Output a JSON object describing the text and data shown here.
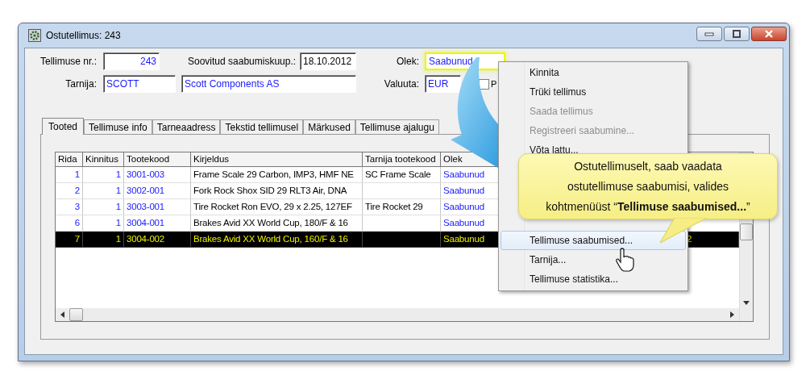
{
  "window": {
    "title": "Ostutellimus: 243"
  },
  "form": {
    "order_no_label": "Tellimuse nr.:",
    "order_no": "243",
    "date_label": "Soovitud saabumiskuup.:",
    "date": "18.10.2012",
    "status_label": "Olek:",
    "status": "Saabunud",
    "status_highlighted": true,
    "supplier_label": "Tarnija:",
    "supplier_code": "SCOTT",
    "supplier_name": "Scott Components AS",
    "currency_label": "Valuuta:",
    "currency": "EUR",
    "checkbox_checked": false,
    "checkbox_label": "P"
  },
  "tabs": [
    {
      "label": "Tooted",
      "selected": true
    },
    {
      "label": "Tellimuse info",
      "selected": false
    },
    {
      "label": "Tarneaadress",
      "selected": false
    },
    {
      "label": "Tekstid tellimusel",
      "selected": false
    },
    {
      "label": "Märkused",
      "selected": false
    },
    {
      "label": "Tellimuse ajalugu",
      "selected": false
    }
  ],
  "table": {
    "columns": [
      "Rida",
      "Kinnitus",
      "Tootekood",
      "Kirjeldus",
      "Tarnija tootekood",
      "Olek"
    ],
    "rows": [
      {
        "rida": "1",
        "kinnitus": "1",
        "tootekood": "3001-003",
        "kirjeldus": "Frame Scale 29 Carbon, IMP3, HMF NE",
        "tarnija_tootekood": "SC Frame Scale",
        "olek": "Saabunud",
        "selected": false
      },
      {
        "rida": "2",
        "kinnitus": "1",
        "tootekood": "3002-001",
        "kirjeldus": "Fork Rock Shox SID 29 RLT3 Air, DNA",
        "olek": "Saabunud",
        "selected": false
      },
      {
        "rida": "3",
        "kinnitus": "1",
        "tootekood": "3003-001",
        "kirjeldus": "Tire Rocket Ron EVO, 29 x 2.25, 127EF",
        "tarnija_tootekood": "Tire Rocket 29",
        "olek": "Saabunud",
        "selected": false
      },
      {
        "rida": "6",
        "kinnitus": "1",
        "tootekood": "3004-001",
        "kirjeldus": "Brakes Avid XX World Cup, 180/F & 16",
        "olek": "Saabunud",
        "selected": false
      },
      {
        "rida": "7",
        "kinnitus": "1",
        "tootekood": "3004-002",
        "kirjeldus": "Brakes Avid XX World Cup, 160/F & 16",
        "olek": "Saabunud",
        "column_7": "2",
        "selected": true
      }
    ]
  },
  "context_menu": {
    "items": [
      {
        "label": "Kinnita",
        "disabled": false
      },
      {
        "label": "Trüki tellimus",
        "disabled": false
      },
      {
        "label": "Saada tellimus",
        "disabled": true
      },
      {
        "label": "Registreeri saabumine...",
        "disabled": true
      },
      {
        "label": "Võta lattu...",
        "disabled": false
      }
    ],
    "lower_items": [
      {
        "label": "Tellimuse saabumised...",
        "selected": true
      },
      {
        "label": "Tarnija...",
        "selected": false
      },
      {
        "label": "Tellimuse statistika...",
        "selected": false
      }
    ]
  },
  "callout": {
    "text": "Ostutellimuselt, saab vaadata\nostutellimuse saabumisi, valides\nkohtmenüüst “**Tellimuse saabumised...**”"
  }
}
